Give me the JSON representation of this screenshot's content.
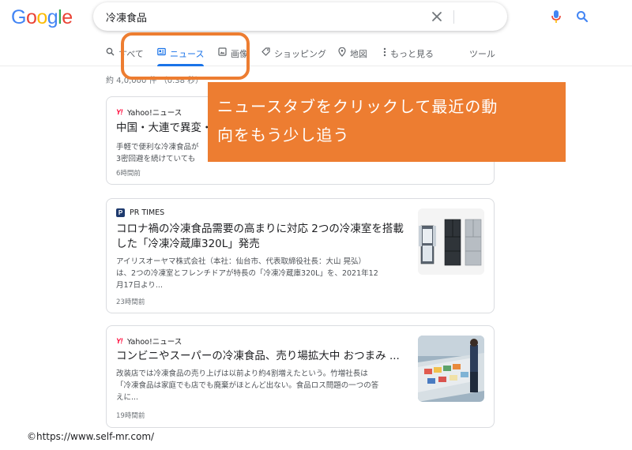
{
  "logo": {
    "letters": [
      "G",
      "o",
      "o",
      "g",
      "l",
      "e"
    ],
    "colors": [
      "#4285f4",
      "#ea4335",
      "#fbbc05",
      "#4285f4",
      "#34a853",
      "#ea4335"
    ]
  },
  "search": {
    "value": "冷凍食品",
    "clear_icon": "close-icon",
    "mic_icon": "mic-icon",
    "search_icon": "search-icon"
  },
  "tabs": [
    {
      "label": "すべて",
      "icon": "search-icon",
      "active": false
    },
    {
      "label": "ニュース",
      "icon": "news-icon",
      "active": true
    },
    {
      "label": "画像",
      "icon": "image-icon",
      "active": false
    },
    {
      "label": "ショッピング",
      "icon": "tag-icon",
      "active": false
    },
    {
      "label": "地図",
      "icon": "map-pin-icon",
      "active": false
    },
    {
      "label": "もっと見る",
      "icon": "more-vert-icon",
      "active": false
    },
    {
      "label": "ツール",
      "icon": "",
      "active": false
    }
  ],
  "stats": "約 4,0,000 件 （0.38 秒）",
  "stats_visible": "約 4█3,000 件 （0.38 秒）",
  "results": [
    {
      "source": "Yahoo!ニュース",
      "source_logo": "Y!",
      "headline": "中国・大連で異変・",
      "snippet_lines": [
        "手軽で便利な冷凍食品が",
        "3密回避を続けていても"
      ],
      "time": "6時間前"
    },
    {
      "source": "PR TIMES",
      "source_logo": "P",
      "headline_lines": [
        "コロナ禍の冷凍食品需要の高まりに対応 2つの冷凍室を搭載",
        "した「冷凍冷蔵庫320L」発売"
      ],
      "snippet_lines": [
        "アイリスオーヤマ株式会社（本社：仙台市、代表取締役社長：大山 晃弘）",
        "は、2つの冷凍室とフレンチドアが特長の「冷凍冷蔵庫320L」を、2021年12",
        "月17日より..."
      ],
      "time": "23時間前"
    },
    {
      "source": "Yahoo!ニュース",
      "source_logo": "Y!",
      "headline": "コンビニやスーパーの冷凍食品、売り場拡大中 おつまみ ...",
      "snippet_lines": [
        "改装店では冷凍食品の売り上げは以前より約4割増えたという。竹増社長は",
        "「冷凍食品は家庭でも店でも廃棄がほとんど出ない。食品ロス問題の一つの答",
        "えに..."
      ],
      "time": "19時間前"
    }
  ],
  "annotation": {
    "callout_lines": [
      "ニュースタブをクリックして最近の動",
      "向をもう少し追う"
    ],
    "color": "#ed7d31"
  },
  "credit": "©https://www.self-mr.com/"
}
